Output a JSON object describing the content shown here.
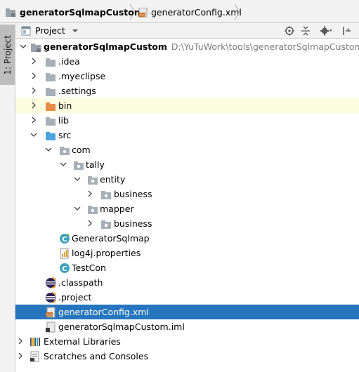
{
  "breadcrumb": {
    "project": "generatorSqlmapCustom",
    "file": "generatorConfig.xml"
  },
  "sidebar": {
    "tab_label": "1: Project"
  },
  "toolbar": {
    "view_label": "Project"
  },
  "tree": {
    "root": {
      "label": "generatorSqlmapCustom",
      "path": "D:\\YuTuWork\\tools\\generatorSqlmapCustom"
    },
    "idea": ".idea",
    "myeclipse": ".myeclipse",
    "settings": ".settings",
    "bin": "bin",
    "lib": "lib",
    "src": "src",
    "com": "com",
    "tally": "tally",
    "entity": "entity",
    "entity_business": "business",
    "mapper": "mapper",
    "mapper_business": "business",
    "generator_sqlmap": "GeneratorSqlmap",
    "log4j": "log4j.properties",
    "testcon": "TestCon",
    "classpath": ".classpath",
    "project": ".project",
    "generator_config": "generatorConfig.xml",
    "iml": "generatorSqlmapCustom.iml",
    "external_libraries": "External Libraries",
    "scratches": "Scratches and Consoles"
  }
}
